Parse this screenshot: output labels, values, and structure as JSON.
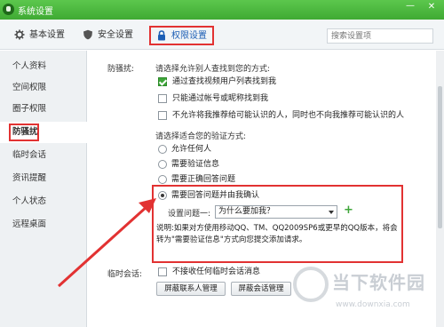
{
  "window": {
    "title": "系统设置",
    "minimize": "—",
    "close": "✕"
  },
  "tabs": [
    {
      "label": "基本设置",
      "icon": "gear-icon"
    },
    {
      "label": "安全设置",
      "icon": "shield-icon"
    },
    {
      "label": "权限设置",
      "icon": "lock-icon"
    }
  ],
  "search": {
    "placeholder": "搜索设置项"
  },
  "sidebar": {
    "items": [
      {
        "label": "个人资料"
      },
      {
        "label": "空间权限"
      },
      {
        "label": "圈子权限"
      },
      {
        "label": "防骚扰",
        "active": true
      },
      {
        "label": "临时会话"
      },
      {
        "label": "资讯提醒"
      },
      {
        "label": "个人状态"
      },
      {
        "label": "远程桌面"
      }
    ]
  },
  "harass": {
    "section_label": "防骚扰:",
    "find_prompt": "请选择允许别人查找到您的方式:",
    "find_options": [
      {
        "label": "通过查找视频用户列表找到我",
        "checked": true
      },
      {
        "label": "只能通过帐号或昵称找到我",
        "checked": false
      },
      {
        "label": "不允许将我推荐给可能认识的人，同时也不向我推荐可能认识的人",
        "checked": false
      }
    ],
    "verify_prompt": "请选择适合您的验证方式:",
    "verify_options": [
      {
        "label": "允许任何人",
        "checked": false
      },
      {
        "label": "需要验证信息",
        "checked": false
      },
      {
        "label": "需要正确回答问题",
        "checked": false
      },
      {
        "label": "需要回答问题并由我确认",
        "checked": true
      }
    ],
    "question_label": "设置问题一:",
    "question_value": "为什么要加我？",
    "add_question": "+",
    "note": "说明:如果对方使用移动QQ、TM、QQ2009SP6或更早的QQ版本，将会转为\"需要验证信息\"方式向您提交添加请求。"
  },
  "temp_chat": {
    "section_label": "临时会话:",
    "option": {
      "label": "不接收任何临时会话消息",
      "checked": false
    },
    "btn_contacts": "屏蔽联系人管理",
    "btn_sessions": "屏蔽会话管理"
  },
  "colors": {
    "titlebar": "#4dbb3f",
    "highlight": "#e23232",
    "accent": "#1d5fb5"
  },
  "watermark": {
    "brand": "当下软件园",
    "url": "www.downxia.com"
  }
}
